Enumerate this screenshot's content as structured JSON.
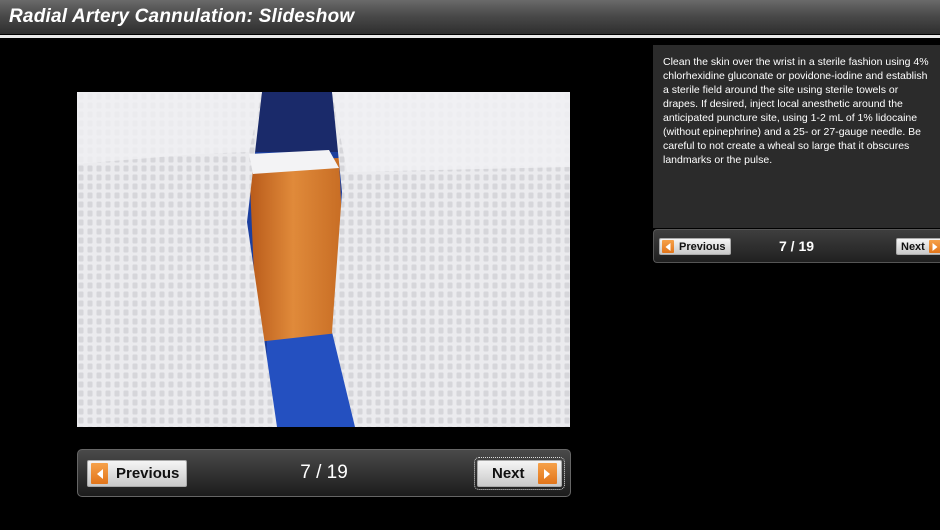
{
  "header": {
    "title": "Radial Artery Cannulation: Slideshow"
  },
  "slide": {
    "image_alt": "Wrist prepared with antiseptic and surrounded by sterile drapes",
    "caption": "Clean the skin over the wrist in a sterile fashion using 4% chlorhexidine gluconate or povidone-iodine and establish a sterile field around the site using sterile towels or drapes. If desired, inject local anesthetic around the anticipated puncture site, using 1-2 mL of 1% lidocaine (without epinephrine) and a 25- or 27-gauge needle. Be careful to not create a wheal so large that it obscures landmarks or the pulse."
  },
  "nav": {
    "previous_label": "Previous",
    "next_label": "Next",
    "counter": "7 / 19"
  },
  "colors": {
    "accent_arrow": "#f08a2c",
    "caption_bg": "#2b2b2b"
  }
}
